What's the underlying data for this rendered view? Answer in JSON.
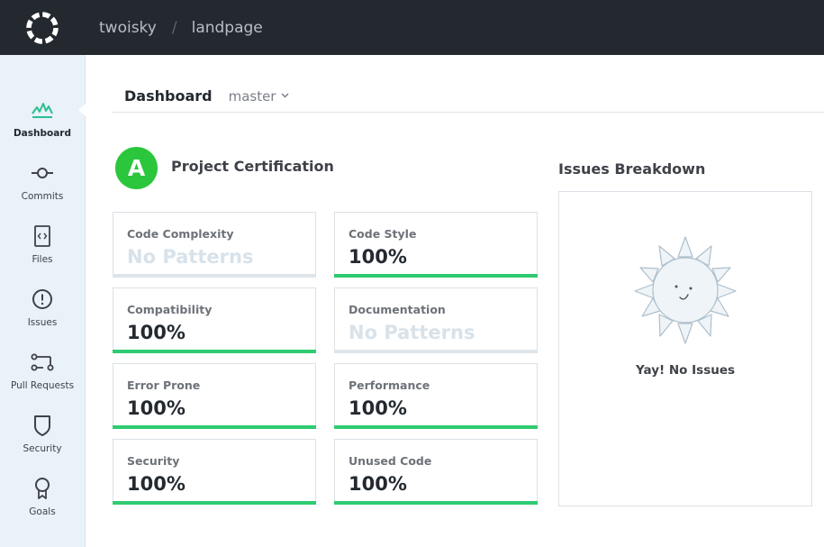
{
  "topbar": {
    "logo_icon": "codacy-logo-icon",
    "org": "twoisky",
    "separator": "/",
    "repo": "landpage"
  },
  "sidebar": {
    "items": [
      {
        "label": "Dashboard",
        "icon": "chart-icon",
        "active": true
      },
      {
        "label": "Commits",
        "icon": "commit-icon",
        "active": false
      },
      {
        "label": "Files",
        "icon": "file-code-icon",
        "active": false
      },
      {
        "label": "Issues",
        "icon": "alert-circle-icon",
        "active": false
      },
      {
        "label": "Pull Requests",
        "icon": "pull-request-icon",
        "active": false
      },
      {
        "label": "Security",
        "icon": "shield-icon",
        "active": false
      },
      {
        "label": "Goals",
        "icon": "award-icon",
        "active": false
      }
    ]
  },
  "header": {
    "title": "Dashboard",
    "branch": "master",
    "branch_chevron": "⌄"
  },
  "certification": {
    "grade": "A",
    "title": "Project Certification"
  },
  "metrics": [
    {
      "name": "Code Complexity",
      "value": "No Patterns",
      "fill_percent": 0
    },
    {
      "name": "Code Style",
      "value": "100%",
      "fill_percent": 100
    },
    {
      "name": "Compatibility",
      "value": "100%",
      "fill_percent": 100
    },
    {
      "name": "Documentation",
      "value": "No Patterns",
      "fill_percent": 0
    },
    {
      "name": "Error Prone",
      "value": "100%",
      "fill_percent": 100
    },
    {
      "name": "Performance",
      "value": "100%",
      "fill_percent": 100
    },
    {
      "name": "Security",
      "value": "100%",
      "fill_percent": 100
    },
    {
      "name": "Unused Code",
      "value": "100%",
      "fill_percent": 100
    }
  ],
  "issues": {
    "title": "Issues Breakdown",
    "empty_message": "Yay! No Issues",
    "illustration_icon": "smiling-sun-icon"
  },
  "colors": {
    "topbar": "#23292f",
    "sidebar": "#e9f1f9",
    "grade_green": "#2bc63c",
    "progress_green": "#2fcb70",
    "progress_empty": "#dee5ea",
    "no_patterns_text": "#d8e2ea"
  }
}
